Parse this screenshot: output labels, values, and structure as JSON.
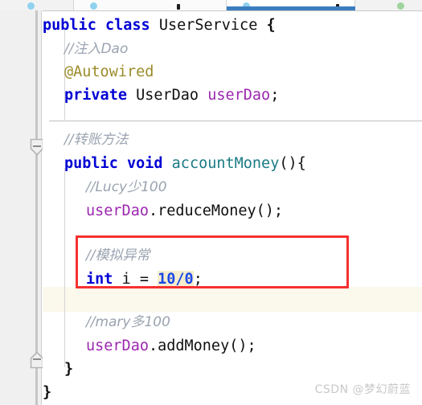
{
  "app": {
    "name": "java-code-editor",
    "accent_color": "#3b7ebf",
    "background": "#ffffff",
    "gutter_color": "#f0f0f0"
  },
  "tabbar": {
    "name": "editor-tab-strip",
    "active_tab_index": 2,
    "tabs": [
      {
        "label": "",
        "icon": "file-icon",
        "active": false
      },
      {
        "label": "",
        "icon": "class-icon",
        "active": false
      },
      {
        "label": "",
        "icon": "class-icon",
        "active": true
      },
      {
        "label": "",
        "icon": "interface-icon",
        "active": false
      }
    ]
  },
  "gutter": {
    "name": "editor-gutter",
    "fold_markers": [
      {
        "type": "fold-collapse-icon",
        "state": "expanded",
        "line": 6
      },
      {
        "type": "fold-collapse-icon",
        "state": "expanded",
        "line": 15
      }
    ]
  },
  "annotation": {
    "name": "red-highlight-box",
    "color": "#f63030",
    "covers_lines": [
      11,
      12
    ]
  },
  "highlight": {
    "token": "10/0",
    "background": "#f6edcd",
    "caret_line_background": "#fbf8ec"
  },
  "colors": {
    "keyword": "#0000d4",
    "identifier": "#101010",
    "field": "#9c27b0",
    "method": "#1a7b85",
    "annotation": "#9b8b2a",
    "number": "#1b49e6",
    "comment": "#9aa3b0"
  },
  "code": {
    "language": "java",
    "class_name": "UserService",
    "lines": [
      {
        "n": 1,
        "indent": 0,
        "tokens": [
          {
            "t": "public",
            "c": "kw"
          },
          {
            "t": " ",
            "c": "punc"
          },
          {
            "t": "class",
            "c": "kw"
          },
          {
            "t": " ",
            "c": "punc"
          },
          {
            "t": "UserService",
            "c": "type"
          },
          {
            "t": " ",
            "c": "punc"
          },
          {
            "t": "{",
            "c": "brace"
          }
        ]
      },
      {
        "n": 2,
        "indent": 1,
        "tokens": [
          {
            "t": "//注入Dao",
            "c": "cmt"
          }
        ]
      },
      {
        "n": 3,
        "indent": 1,
        "tokens": [
          {
            "t": "@Autowired",
            "c": "anno"
          }
        ]
      },
      {
        "n": 4,
        "indent": 1,
        "tokens": [
          {
            "t": "private",
            "c": "kw"
          },
          {
            "t": " ",
            "c": "punc"
          },
          {
            "t": "UserDao",
            "c": "type"
          },
          {
            "t": " ",
            "c": "punc"
          },
          {
            "t": "userDao",
            "c": "field"
          },
          {
            "t": ";",
            "c": "punc"
          }
        ]
      },
      {
        "n": 5,
        "indent": 1,
        "tokens": []
      },
      {
        "n": 6,
        "indent": 1,
        "tokens": [
          {
            "t": "//转账方法",
            "c": "cmt"
          }
        ]
      },
      {
        "n": 7,
        "indent": 1,
        "tokens": [
          {
            "t": "public",
            "c": "kw"
          },
          {
            "t": " ",
            "c": "punc"
          },
          {
            "t": "void",
            "c": "kw"
          },
          {
            "t": " ",
            "c": "punc"
          },
          {
            "t": "accountMoney",
            "c": "method"
          },
          {
            "t": "(){",
            "c": "punc"
          }
        ]
      },
      {
        "n": 8,
        "indent": 2,
        "tokens": [
          {
            "t": "//Lucy少100",
            "c": "cmt"
          }
        ]
      },
      {
        "n": 9,
        "indent": 2,
        "tokens": [
          {
            "t": "userDao",
            "c": "field"
          },
          {
            "t": ".",
            "c": "punc"
          },
          {
            "t": "reduceMoney",
            "c": "ident"
          },
          {
            "t": "();",
            "c": "punc"
          }
        ]
      },
      {
        "n": 10,
        "indent": 2,
        "tokens": []
      },
      {
        "n": 11,
        "indent": 2,
        "tokens": [
          {
            "t": "//模拟异常",
            "c": "cmt"
          }
        ]
      },
      {
        "n": 12,
        "indent": 2,
        "tokens": [
          {
            "t": "int",
            "c": "kw"
          },
          {
            "t": " ",
            "c": "punc"
          },
          {
            "t": "i",
            "c": "ident"
          },
          {
            "t": " = ",
            "c": "punc"
          },
          {
            "t": "10",
            "c": "num numhl"
          },
          {
            "t": "/",
            "c": "num numhl"
          },
          {
            "t": "0",
            "c": "num numhl"
          },
          {
            "t": ";",
            "c": "punc"
          }
        ]
      },
      {
        "n": 13,
        "indent": 2,
        "tokens": []
      },
      {
        "n": 14,
        "indent": 2,
        "tokens": [
          {
            "t": "//mary多100",
            "c": "cmt"
          }
        ]
      },
      {
        "n": 15,
        "indent": 2,
        "tokens": [
          {
            "t": "userDao",
            "c": "field"
          },
          {
            "t": ".",
            "c": "punc"
          },
          {
            "t": "addMoney",
            "c": "ident"
          },
          {
            "t": "();",
            "c": "punc"
          }
        ]
      },
      {
        "n": 16,
        "indent": 1,
        "tokens": [
          {
            "t": "}",
            "c": "brace"
          }
        ]
      },
      {
        "n": 17,
        "indent": 0,
        "tokens": [
          {
            "t": "}",
            "c": "brace"
          }
        ]
      }
    ],
    "plain_text": [
      "public class UserService {",
      "    //注入Dao",
      "    @Autowired",
      "    private UserDao userDao;",
      "",
      "    //转账方法",
      "    public void accountMoney(){",
      "        //Lucy少100",
      "        userDao.reduceMoney();",
      "",
      "        //模拟异常",
      "        int i = 10/0;",
      "",
      "        //mary多100",
      "        userDao.addMoney();",
      "    }",
      "}"
    ]
  },
  "watermark": {
    "text": "CSDN @梦幻蔚蓝"
  }
}
